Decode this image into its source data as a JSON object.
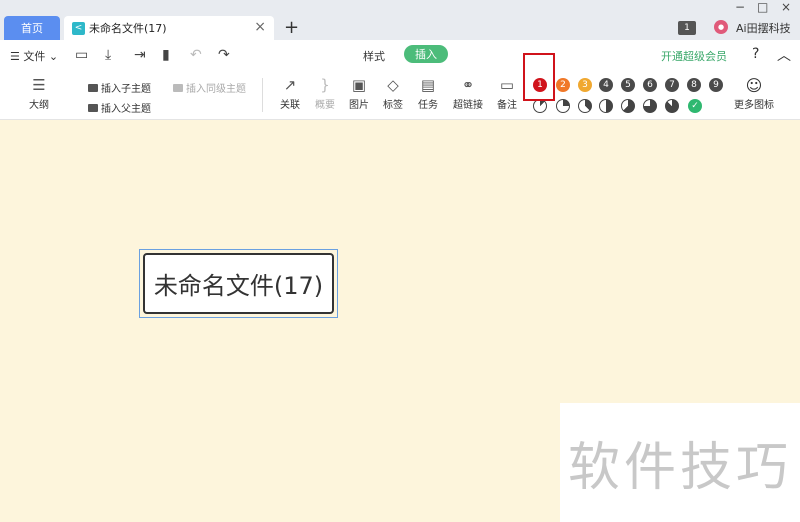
{
  "tabs": {
    "home": "首页",
    "doc": "未命名文件(17)",
    "close": "×",
    "add": "+"
  },
  "window": {
    "minimize": "−",
    "maximize": "□",
    "close": "×"
  },
  "user": {
    "badge": "1",
    "name": "Ai田摆科技"
  },
  "toolbar": {
    "file_menu": "☰ 文件 ⌄",
    "style_tab": "样式",
    "insert_tab": "插入",
    "vip": "开通超级会员",
    "help": "?",
    "collapse": "︿"
  },
  "insert": {
    "outline": "大纲",
    "insert_child": "插入子主题",
    "insert_parent": "插入父主题",
    "insert_sibling": "插入同级主题",
    "relation": "关联",
    "summary": "概要",
    "image": "图片",
    "tag": "标签",
    "task": "任务",
    "hyperlink": "超链接",
    "note": "备注",
    "more_icons": "更多图标"
  },
  "priorities": [
    {
      "label": "1",
      "color": "#d0131b"
    },
    {
      "label": "2",
      "color": "#f07828"
    },
    {
      "label": "3",
      "color": "#f0a830"
    },
    {
      "label": "4",
      "color": "#4a4a4a"
    },
    {
      "label": "5",
      "color": "#4a4a4a"
    },
    {
      "label": "6",
      "color": "#4a4a4a"
    },
    {
      "label": "7",
      "color": "#4a4a4a"
    },
    {
      "label": "8",
      "color": "#4a4a4a"
    },
    {
      "label": "9",
      "color": "#4a4a4a"
    }
  ],
  "canvas": {
    "root_topic": "未命名文件(17)",
    "background": "#fdf5dc"
  },
  "watermark": "软件技巧"
}
